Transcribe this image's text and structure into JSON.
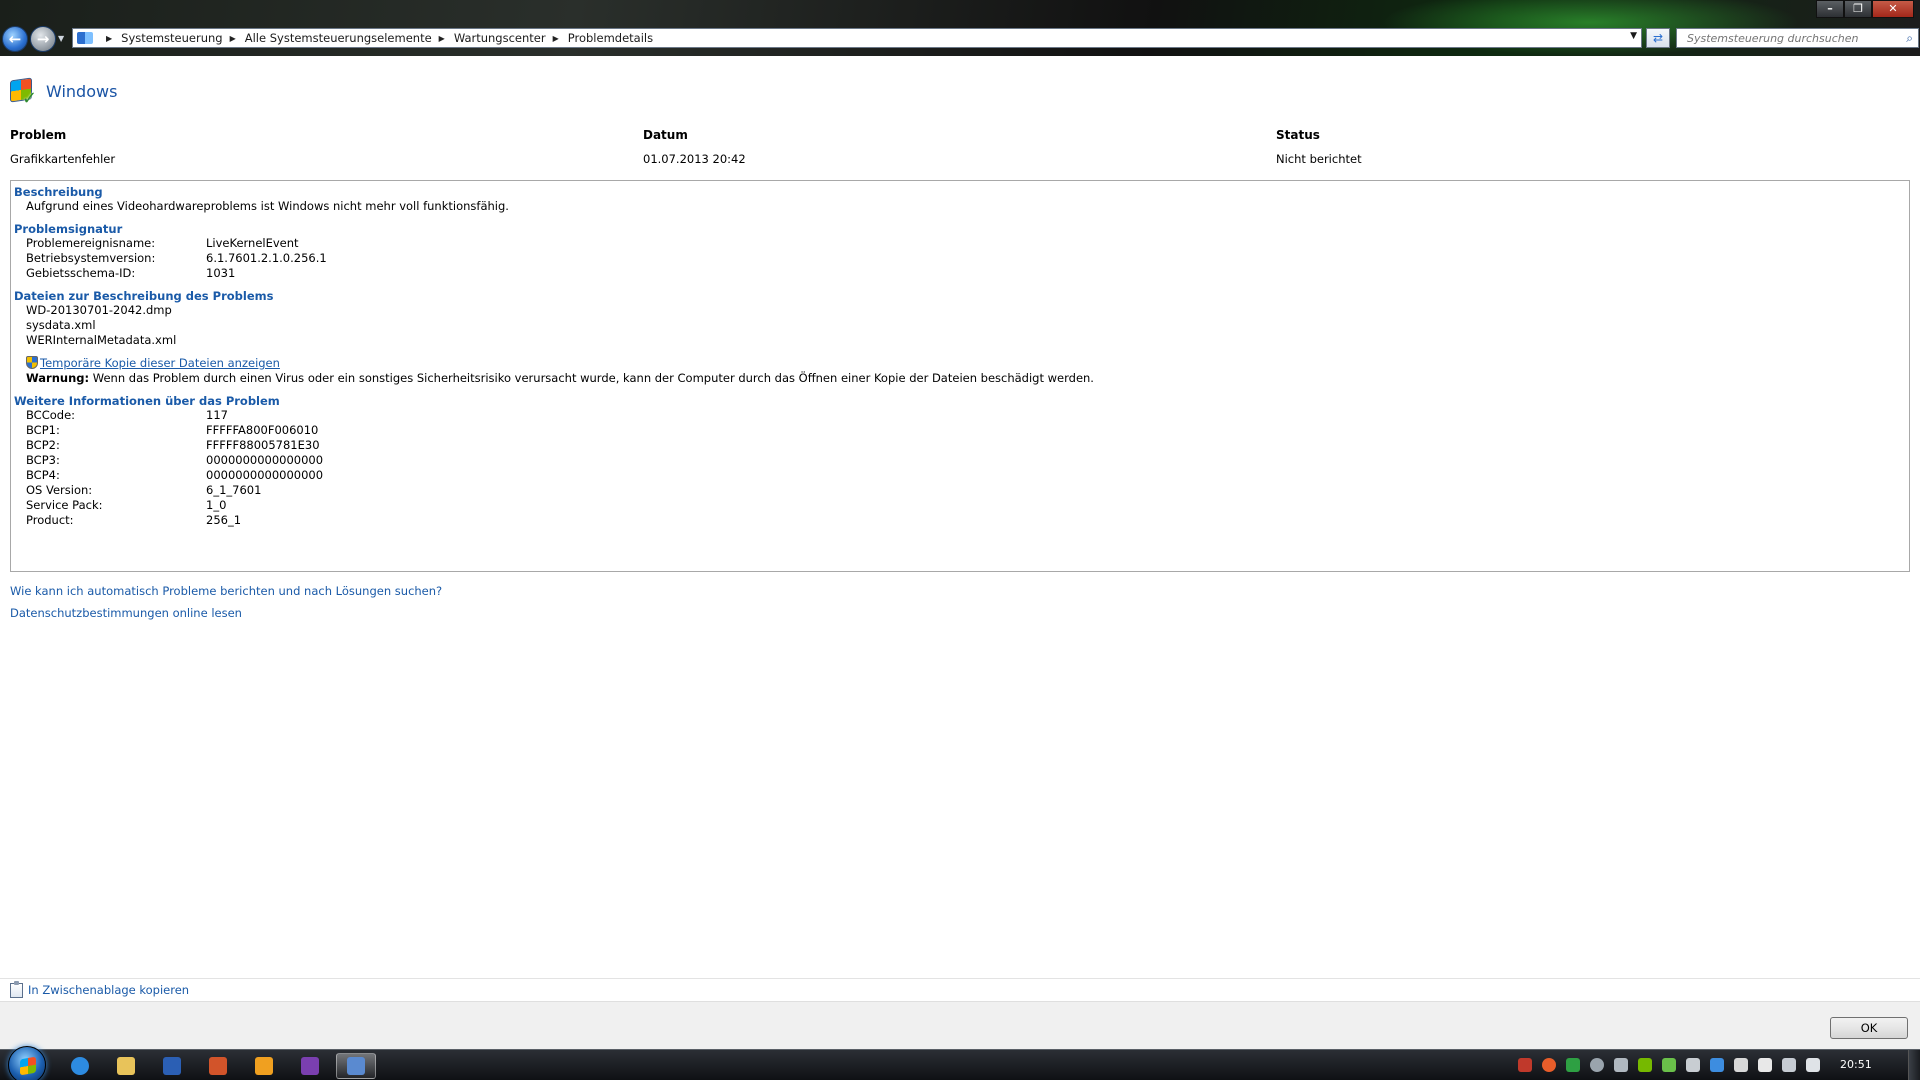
{
  "window": {
    "minimize_label": "–",
    "maximize_label": "❐",
    "close_label": "✕"
  },
  "nav": {
    "back_glyph": "←",
    "forward_glyph": "→"
  },
  "address": {
    "crumbs": [
      "Systemsteuerung",
      "Alle Systemsteuerungselemente",
      "Wartungscenter",
      "Problemdetails"
    ],
    "refresh_glyph": "⇄"
  },
  "search": {
    "placeholder": "Systemsteuerung durchsuchen",
    "icon_glyph": "⌕"
  },
  "header": {
    "title": "Windows"
  },
  "summary": {
    "problem_label": "Problem",
    "problem_value": "Grafikkartenfehler",
    "date_label": "Datum",
    "date_value": "01.07.2013 20:42",
    "status_label": "Status",
    "status_value": "Nicht berichtet"
  },
  "details": {
    "description_title": "Beschreibung",
    "description_text": "Aufgrund eines Videohardwareproblems ist Windows nicht mehr voll funktionsfähig.",
    "signature_title": "Problemsignatur",
    "signature": [
      {
        "key": "Problemereignisname:",
        "value": "LiveKernelEvent"
      },
      {
        "key": "Betriebsystemversion:",
        "value": "6.1.7601.2.1.0.256.1"
      },
      {
        "key": "Gebietsschema-ID:",
        "value": "1031"
      }
    ],
    "files_title": "Dateien zur Beschreibung des Problems",
    "files": [
      "WD-20130701-2042.dmp",
      "sysdata.xml",
      "WERInternalMetadata.xml"
    ],
    "temp_copy_link": "Temporäre Kopie dieser Dateien anzeigen",
    "warning_label": "Warnung:",
    "warning_text": " Wenn das Problem durch einen Virus oder ein sonstiges Sicherheitsrisiko verursacht wurde, kann der Computer durch das Öffnen einer Kopie der Dateien beschädigt werden.",
    "more_title": "Weitere Informationen über das Problem",
    "more": [
      {
        "key": "BCCode:",
        "value": "117"
      },
      {
        "key": "BCP1:",
        "value": "FFFFFA800F006010"
      },
      {
        "key": "BCP2:",
        "value": "FFFFF88005781E30"
      },
      {
        "key": "BCP3:",
        "value": "0000000000000000"
      },
      {
        "key": "BCP4:",
        "value": "0000000000000000"
      },
      {
        "key": "OS Version:",
        "value": "6_1_7601"
      },
      {
        "key": "Service Pack:",
        "value": "1_0"
      },
      {
        "key": "Product:",
        "value": "256_1"
      }
    ]
  },
  "footer_links": {
    "auto_report": "Wie kann ich automatisch Probleme berichten und nach Lösungen suchen?",
    "privacy": "Datenschutzbestimmungen online lesen"
  },
  "bottom": {
    "copy_link": "In Zwischenablage kopieren",
    "ok_label": "OK"
  },
  "taskbar": {
    "clock": "20:51",
    "apps": [
      {
        "name": "internet-explorer",
        "color": "#2d8be0"
      },
      {
        "name": "explorer",
        "color": "#e8c35a"
      },
      {
        "name": "word",
        "color": "#2b5fb4"
      },
      {
        "name": "firewall-app",
        "color": "#d2542a"
      },
      {
        "name": "media-player",
        "color": "#f0a020"
      },
      {
        "name": "visual-studio",
        "color": "#7a3fb0"
      },
      {
        "name": "control-panel",
        "color": "#5a8ad0"
      }
    ]
  }
}
